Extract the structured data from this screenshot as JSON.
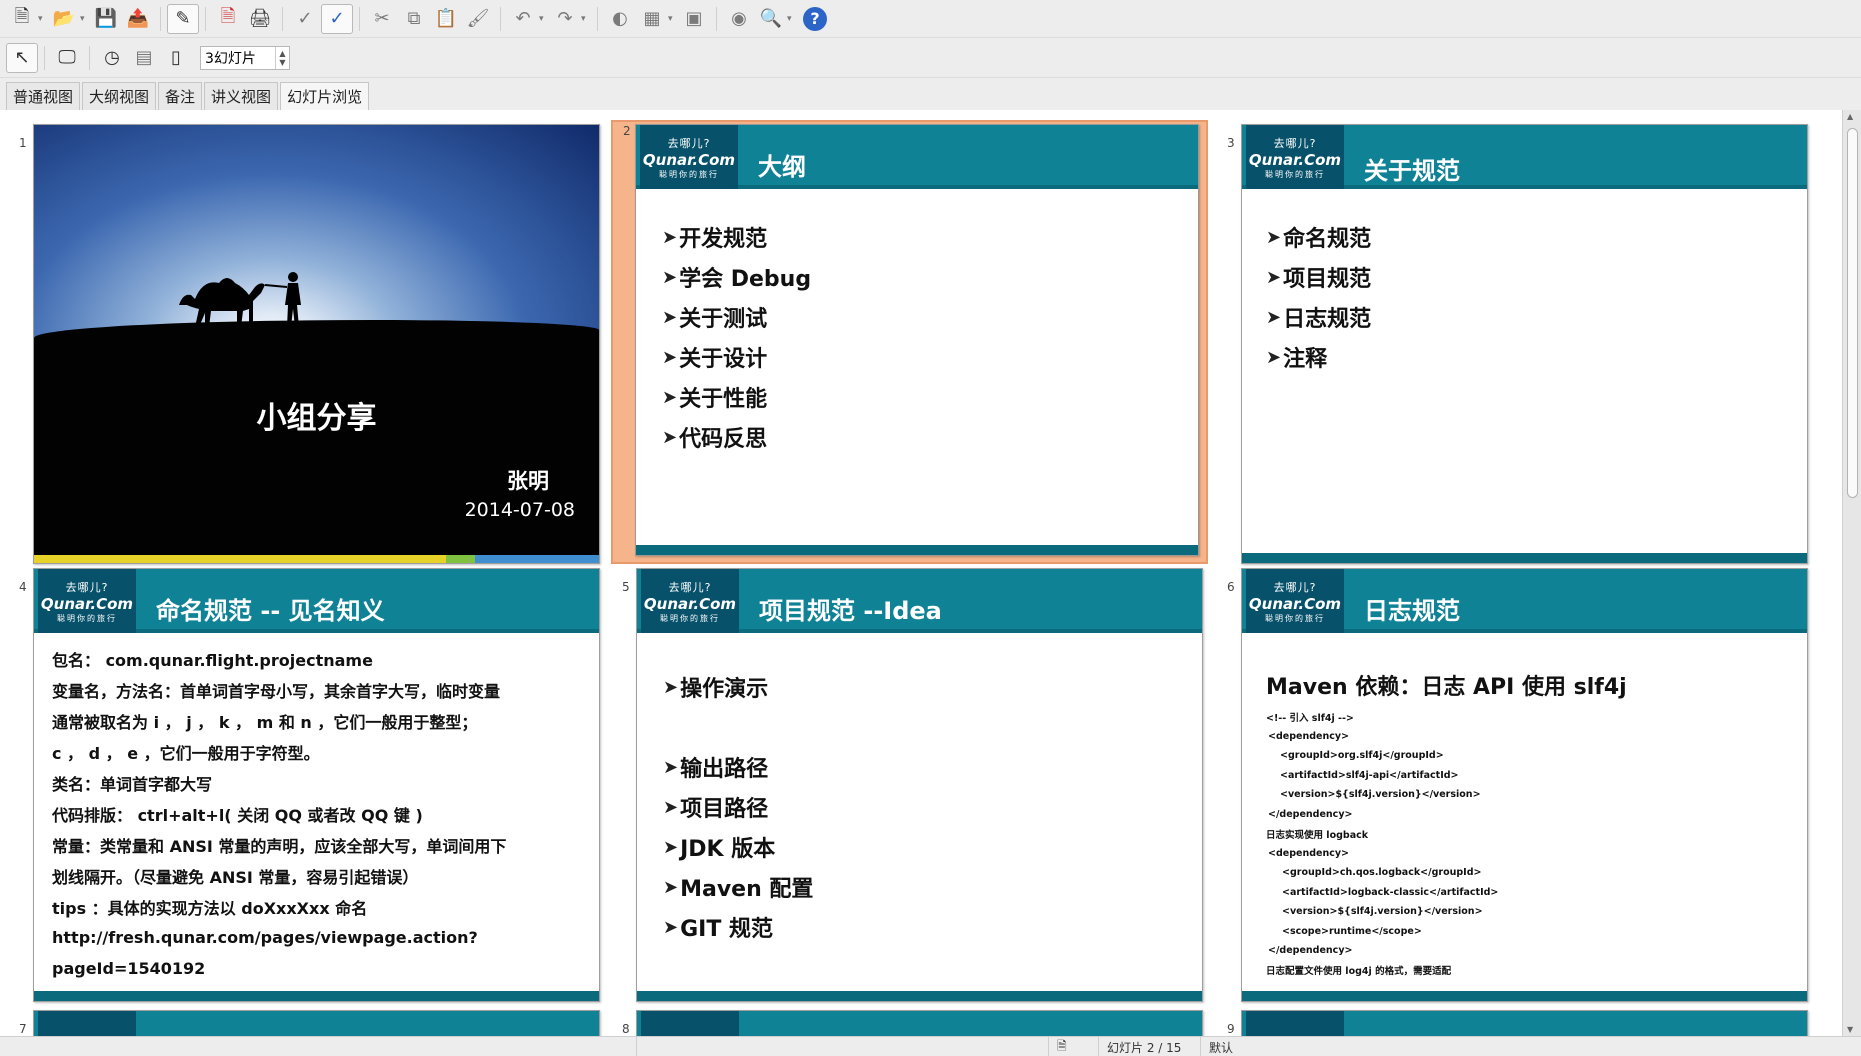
{
  "toolbar1": {
    "icons": [
      "new-document-icon",
      "open-folder-icon",
      "save-icon",
      "export-icon",
      "edit-file-icon",
      "export-pdf-icon",
      "print-icon",
      "spellcheck-icon",
      "autospell-icon",
      "cut-icon",
      "copy-icon",
      "paste-icon",
      "clone-formatting-icon",
      "undo-icon",
      "redo-icon",
      "chart-icon",
      "table-icon",
      "show-draw-icon",
      "navigator-icon",
      "zoom-icon"
    ],
    "help_label": "?"
  },
  "toolbar2": {
    "slides_per_row": "3幻灯片"
  },
  "tabs": [
    {
      "label": "普通视图"
    },
    {
      "label": "大纲视图"
    },
    {
      "label": "备注"
    },
    {
      "label": "讲义视图"
    },
    {
      "label": "幻灯片浏览"
    }
  ],
  "slides": [
    {
      "number": "1",
      "title": "小组分享",
      "author": "张明",
      "date": "2014-07-08"
    },
    {
      "number": "2",
      "title": "大纲",
      "bullets": [
        "开发规范",
        "学会 Debug",
        "关于测试",
        "关于设计",
        "关于性能",
        "代码反思"
      ]
    },
    {
      "number": "3",
      "title": "关于规范",
      "bullets": [
        "命名规范",
        "项目规范",
        "日志规范",
        "注释"
      ]
    },
    {
      "number": "4",
      "title": "命名规范 -- 见名知义",
      "lines": [
        "包名： com.qunar.flight.projectname",
        "变量名，方法名：首单词首字母小写，其余首字大写，临时变量",
        "通常被取名为 i ， j ， k ， m 和 n ，它们一般用于整型；",
        "c ， d ， e ，它们一般用于字符型。",
        "类名：单词首字都大写",
        "代码排版： ctrl+alt+l( 关闭 QQ 或者改 QQ 键 )",
        "常量：类常量和 ANSI 常量的声明，应该全部大写，单词间用下",
        "划线隔开。（尽量避免 ANSI 常量，容易引起错误）",
        "tips ：具体的实现方法以 doXxxXxx  命名",
        "http://fresh.qunar.com/pages/viewpage.action?",
        "pageId=1540192"
      ]
    },
    {
      "number": "5",
      "title": "项目规范 --Idea",
      "bullets": [
        "操作演示",
        "输出路径",
        "项目路径",
        "JDK 版本",
        "Maven 配置",
        "GIT 规范"
      ]
    },
    {
      "number": "6",
      "title": "日志规范",
      "heading": "Maven 依赖：日志 API 使用 slf4j",
      "lines": [
        "<!-- 引入 slf4j -->",
        "<dependency>",
        "<groupId>org.slf4j</groupId>",
        "<artifactId>slf4j-api</artifactId>",
        "<version>${slf4j.version}</version>",
        "</dependency>",
        "日志实现使用 logback",
        "<dependency>",
        "<groupId>ch.qos.logback</groupId>",
        "<artifactId>logback-classic</artifactId>",
        "<version>${slf4j.version}</version>",
        "<scope>runtime</scope>",
        "</dependency>",
        "日志配置文件使用 log4j 的格式，需要适配"
      ]
    },
    {
      "number": "7"
    },
    {
      "number": "8"
    },
    {
      "number": "9"
    }
  ],
  "logo": {
    "line1": "去哪儿?",
    "line2": "Qunar.Com",
    "line3": "聪明你的旅行"
  },
  "status": {
    "slide_counter": "幻灯片 2 / 15",
    "layout": "默认"
  },
  "colors": {
    "header": "#0f8296",
    "header_dark": "#0b6b7c",
    "selected": "#f6b48a"
  }
}
